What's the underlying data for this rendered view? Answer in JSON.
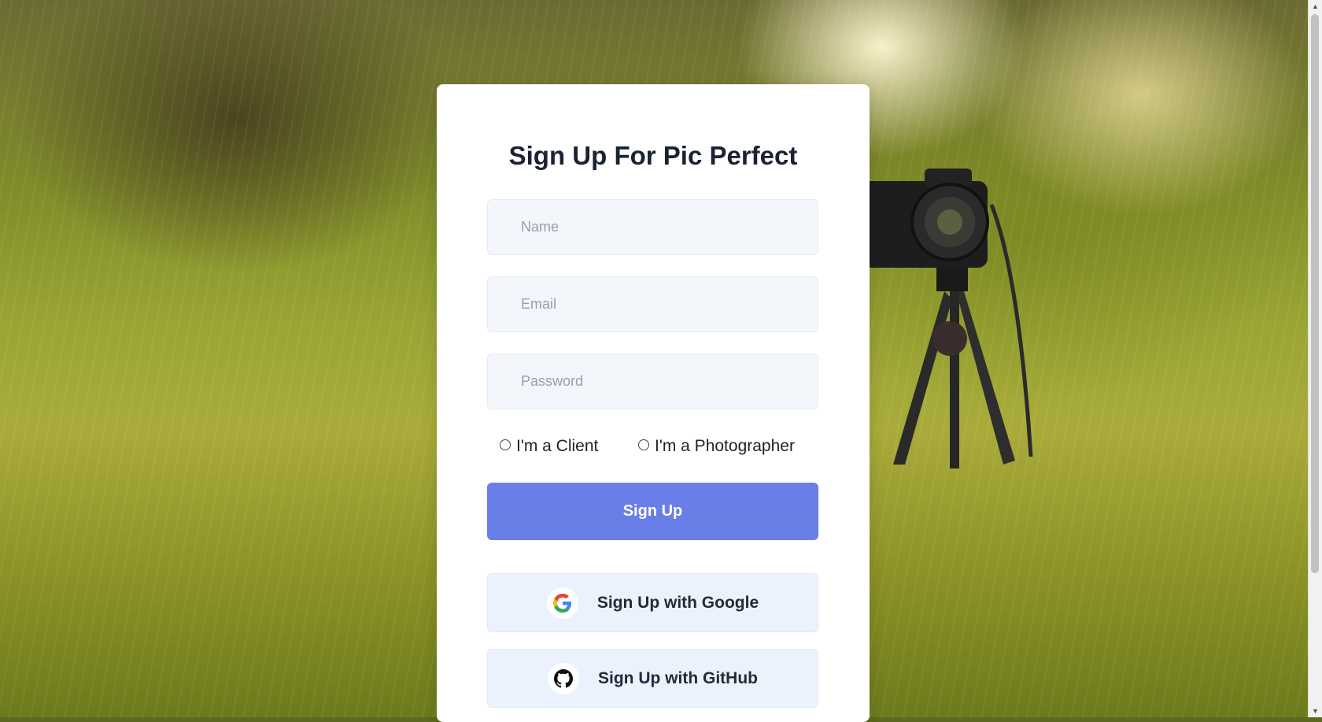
{
  "page": {
    "title": "Sign Up For Pic Perfect"
  },
  "form": {
    "name_placeholder": "Name",
    "email_placeholder": "Email",
    "password_placeholder": "Password",
    "role_options": [
      {
        "label": "I'm a Client",
        "selected": false
      },
      {
        "label": "I'm a Photographer",
        "selected": false
      }
    ],
    "submit_label": "Sign Up"
  },
  "social": {
    "google_label": "Sign Up with Google",
    "github_label": "Sign Up with GitHub"
  },
  "colors": {
    "primary": "#6a7ee8",
    "social_bg": "#ebf2fd",
    "title": "#1a2233"
  },
  "icons": [
    "google-icon",
    "github-icon"
  ]
}
